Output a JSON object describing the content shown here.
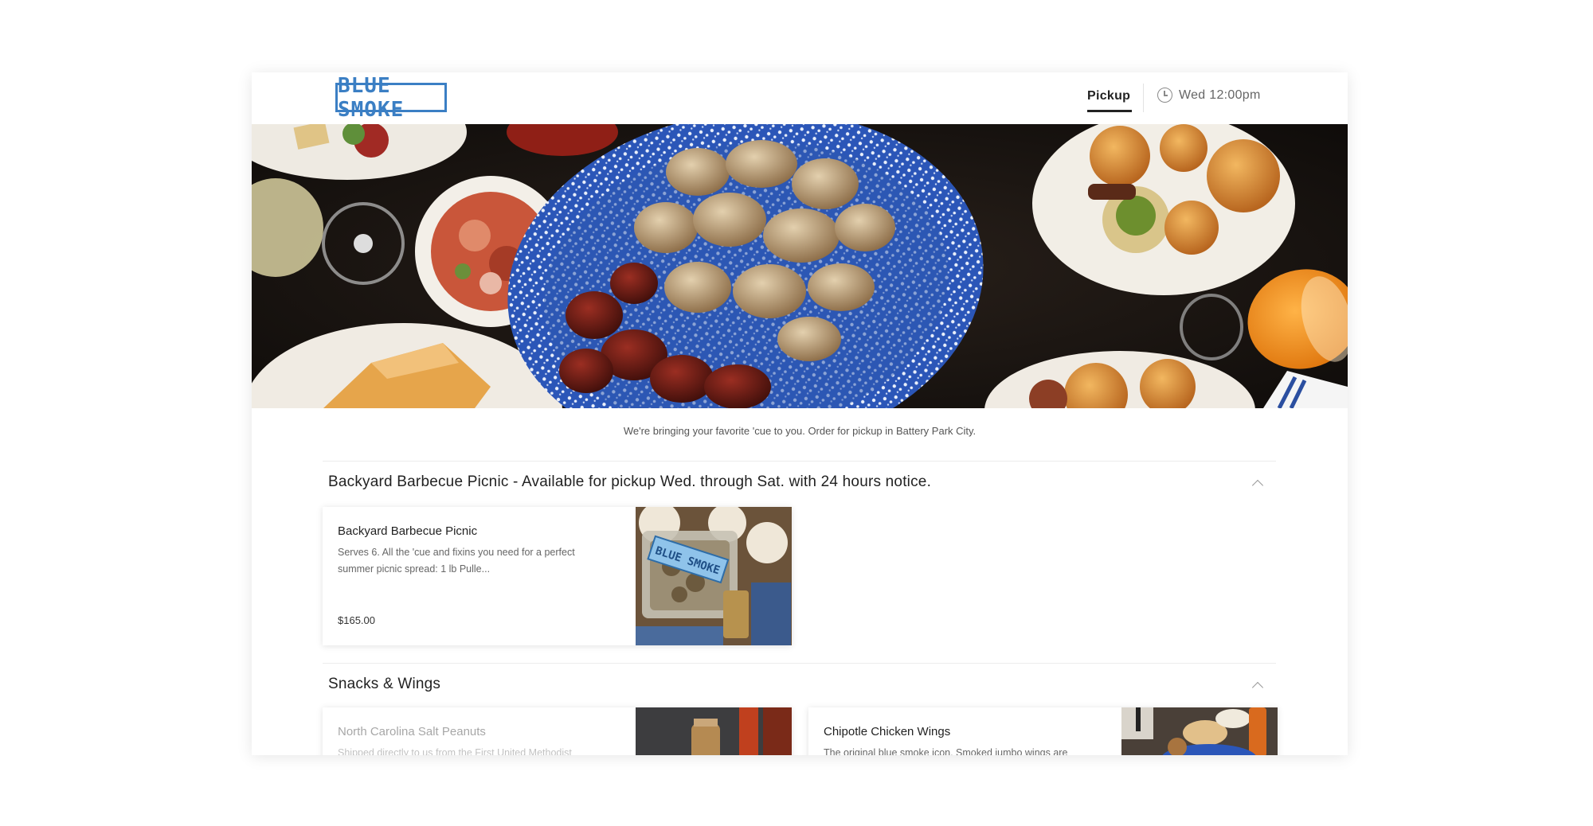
{
  "header": {
    "logo_text": "BLUE SMOKE",
    "nav_pickup": "Pickup",
    "nav_time": "Wed 12:00pm"
  },
  "tagline": "We're bringing your favorite 'cue to you. Order for pickup in Battery Park City.",
  "sections": [
    {
      "title": "Backyard Barbecue Picnic - Available for pickup Wed. through Sat. with 24 hours notice.",
      "items": [
        {
          "name": "Backyard Barbecue Picnic",
          "description": "Serves 6. All the 'cue and fixins you need for a perfect summer picnic spread: 1 lb Pulle...",
          "price": "$165.00",
          "image_label": "BLUE SMOKE"
        }
      ]
    },
    {
      "title": "Snacks & Wings",
      "items": [
        {
          "name": "North Carolina Salt Peanuts",
          "description": "Shipped directly to us from the First United Methodist"
        },
        {
          "name": "Chipotle Chicken Wings",
          "description": "The original blue smoke icon. Smoked jumbo wings are"
        }
      ]
    }
  ],
  "colors": {
    "brand_blue": "#3b7fc4",
    "hero_bg": "#1b1714"
  }
}
